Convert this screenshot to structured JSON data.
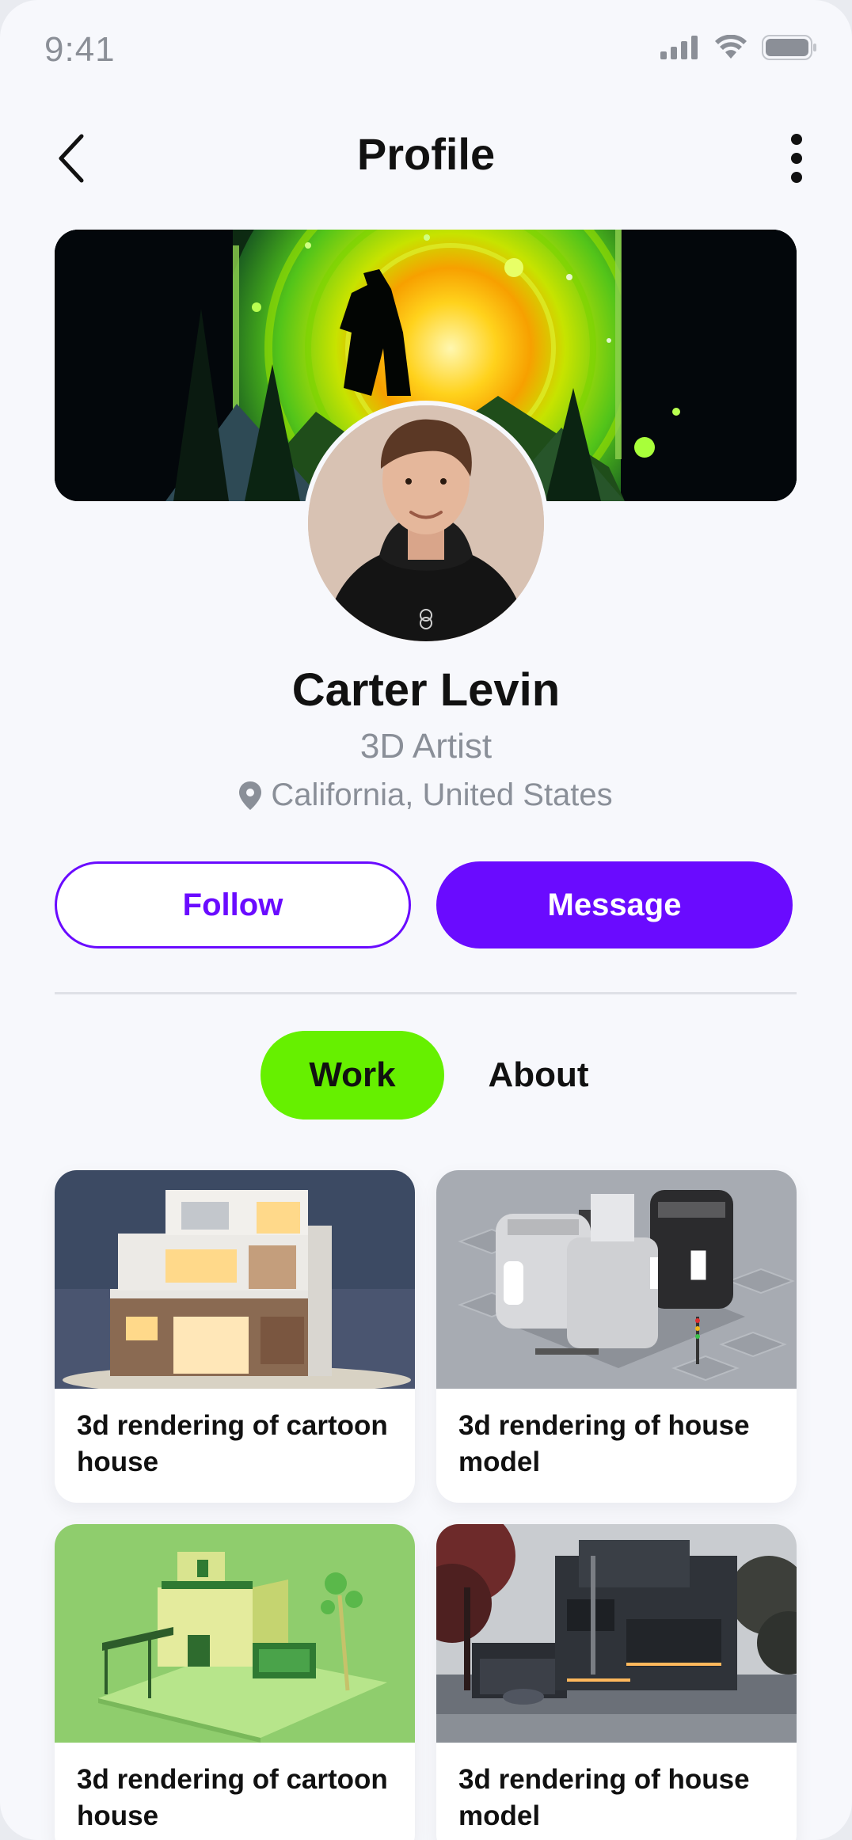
{
  "status_bar": {
    "time": "9:41"
  },
  "header": {
    "title": "Profile"
  },
  "profile": {
    "name": "Carter Levin",
    "role": "3D Artist",
    "location": "California, United States"
  },
  "actions": {
    "follow_label": "Follow",
    "message_label": "Message"
  },
  "tabs": [
    {
      "label": "Work",
      "active": true
    },
    {
      "label": "About",
      "active": false
    }
  ],
  "works": [
    {
      "title": "3d rendering of cartoon house"
    },
    {
      "title": "3d rendering of house model"
    },
    {
      "title": "3d rendering of cartoon house"
    },
    {
      "title": "3d rendering of house model"
    }
  ],
  "colors": {
    "accent": "#6a0bff",
    "active_tab": "#66f000",
    "background": "#f7f8fc"
  }
}
